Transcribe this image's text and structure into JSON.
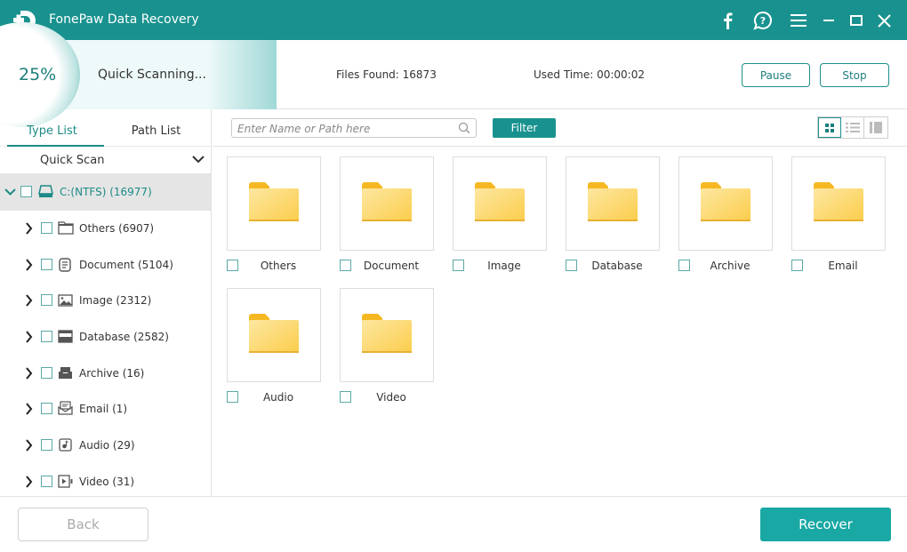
{
  "app": {
    "title": "FonePaw Data Recovery"
  },
  "titlebar_icons": [
    "facebook-icon",
    "help-chat-icon",
    "menu-icon",
    "minimize-icon",
    "maximize-icon",
    "close-icon"
  ],
  "scan": {
    "progress_percent": 25,
    "progress_label": "25%",
    "status": "Quick Scanning...",
    "files_found": "Files Found: 16873",
    "used_time": "Used Time: 00:00:02",
    "pause_label": "Pause",
    "stop_label": "Stop"
  },
  "sidebar": {
    "tabs": [
      {
        "label": "Type List",
        "active": true
      },
      {
        "label": "Path List",
        "active": false
      }
    ],
    "scan_mode": "Quick Scan",
    "drive": {
      "label": "C:(NTFS) (16977)",
      "expanded": true,
      "checked": false
    },
    "items": [
      {
        "label": "Others (6907)",
        "icon": "folder-icon"
      },
      {
        "label": "Document (5104)",
        "icon": "document-icon"
      },
      {
        "label": "Image (2312)",
        "icon": "image-icon"
      },
      {
        "label": "Database (2582)",
        "icon": "database-icon"
      },
      {
        "label": "Archive (16)",
        "icon": "archive-icon"
      },
      {
        "label": "Email (1)",
        "icon": "email-icon"
      },
      {
        "label": "Audio (29)",
        "icon": "audio-icon"
      },
      {
        "label": "Video (31)",
        "icon": "video-icon"
      }
    ]
  },
  "toolbar": {
    "search_placeholder": "Enter Name or Path here",
    "search_value": "",
    "filter_label": "Filter",
    "view_modes": [
      "grid-view",
      "list-view",
      "detail-view"
    ],
    "active_view": "grid-view"
  },
  "tiles": [
    {
      "label": "Others"
    },
    {
      "label": "Document"
    },
    {
      "label": "Image"
    },
    {
      "label": "Database"
    },
    {
      "label": "Archive"
    },
    {
      "label": "Email"
    },
    {
      "label": "Audio"
    },
    {
      "label": "Video"
    }
  ],
  "footer": {
    "back_label": "Back",
    "recover_label": "Recover"
  },
  "colors": {
    "accent": "#19928f",
    "recover": "#19a8a4",
    "folder": "#fcd56b"
  }
}
